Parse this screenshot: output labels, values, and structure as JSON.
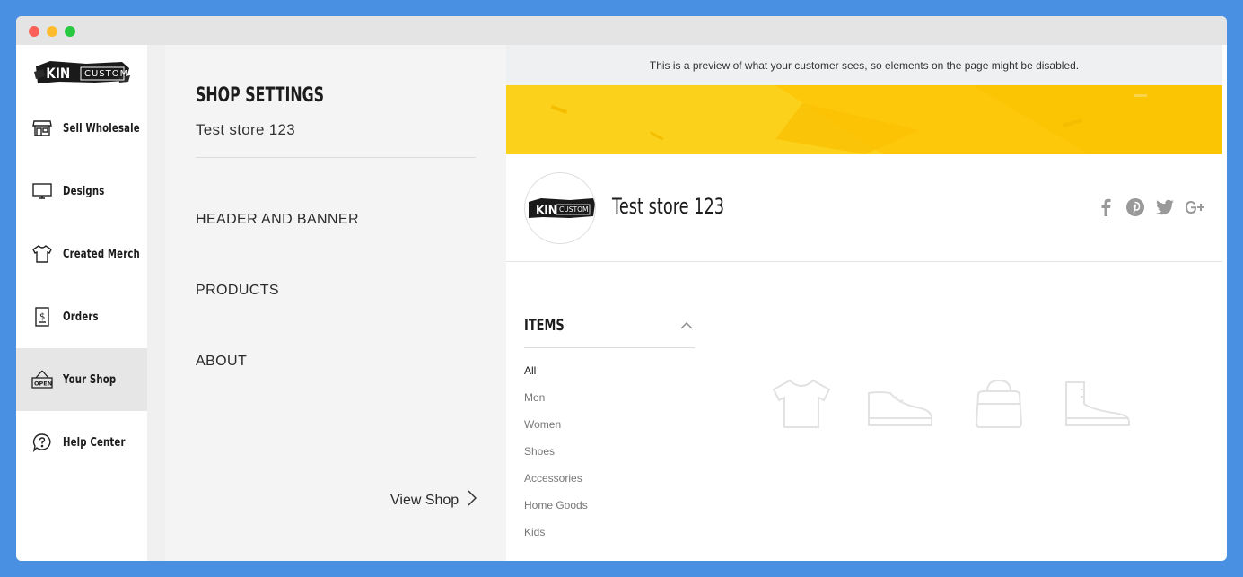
{
  "nav": {
    "logo_text": "KIN CUSTOM",
    "items": [
      {
        "label": "Sell Wholesale",
        "icon": "storefront-icon"
      },
      {
        "label": "Designs",
        "icon": "monitor-icon"
      },
      {
        "label": "Created Merch",
        "icon": "tshirt-icon"
      },
      {
        "label": "Orders",
        "icon": "receipt-icon"
      },
      {
        "label": "Your Shop",
        "icon": "open-sign-icon",
        "active": true
      },
      {
        "label": "Help Center",
        "icon": "help-bubble-icon"
      }
    ]
  },
  "settings": {
    "title": "SHOP SETTINGS",
    "store_name": "Test store 123",
    "menu": [
      "HEADER AND BANNER",
      "PRODUCTS",
      "ABOUT"
    ],
    "view_shop": "View Shop"
  },
  "preview": {
    "notice": "This is a preview of what your customer sees, so elements on the page might be disabled.",
    "banner_color": "#fdc80a",
    "store_title": "Test store 123",
    "social_icons": [
      "facebook-icon",
      "pinterest-icon",
      "twitter-icon",
      "google-plus-icon"
    ],
    "items_title": "ITEMS",
    "categories": [
      "All",
      "Men",
      "Women",
      "Shoes",
      "Accessories",
      "Home Goods",
      "Kids"
    ],
    "selected_category": "All",
    "placeholder_icons": [
      "tshirt-icon",
      "sneaker-icon",
      "bag-icon",
      "boot-icon"
    ]
  }
}
